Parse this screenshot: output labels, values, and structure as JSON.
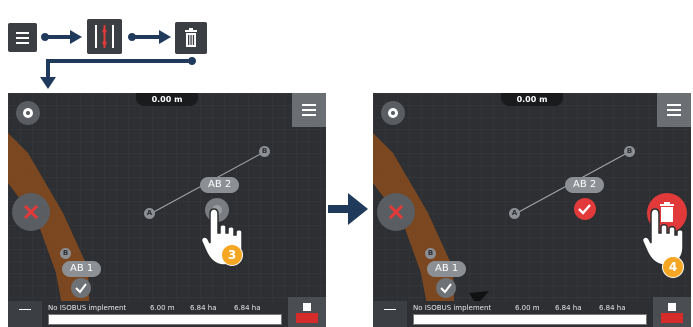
{
  "sequence": {
    "steps": [
      "menu-icon",
      "ab-lines-icon",
      "trash-icon"
    ]
  },
  "screens": [
    {
      "distance": "0.00 m",
      "lines": [
        {
          "label": "AB 2",
          "point_a": "A",
          "point_b": "B"
        },
        {
          "label": "AB 1",
          "point_a": "B"
        }
      ],
      "status": {
        "implement": "No ISOBUS implement",
        "width": "6.00 m",
        "area1": "6.84 ha",
        "area2": "6.84 ha"
      },
      "step_badge": "3"
    },
    {
      "distance": "0.00 m",
      "lines": [
        {
          "label": "AB 2",
          "point_a": "A",
          "point_b": "B"
        },
        {
          "label": "AB 1",
          "point_a": "B"
        }
      ],
      "status": {
        "implement": "No ISOBUS implement",
        "width": "6.00 m",
        "area1": "6.84 ha",
        "area2": "6.84 ha"
      },
      "step_badge": "4"
    }
  ],
  "colors": {
    "accent_red": "#e23a3a",
    "badge_orange": "#f5a623",
    "screen_bg": "#2d2f32",
    "track_orange": "#8a4b1f",
    "arrow_blue": "#1f3a5a"
  }
}
